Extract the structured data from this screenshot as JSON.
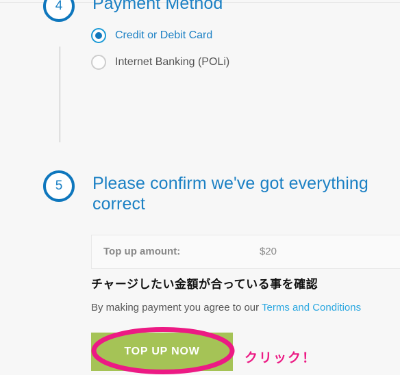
{
  "steps": [
    {
      "number": "4",
      "heading": "Payment Method",
      "options": [
        {
          "label": "Credit or Debit Card",
          "selected": true
        },
        {
          "label": "Internet Banking (POLi)",
          "selected": false
        }
      ]
    },
    {
      "number": "5",
      "heading": "Please confirm we've got everything correct"
    }
  ],
  "summary": {
    "label": "Top up amount:",
    "value": "$20"
  },
  "annotations": {
    "confirm_amount": "チャージしたい金額が合っている事を確認",
    "click_here": "クリック！",
    "highlight_color": "#ec1a84"
  },
  "terms": {
    "prefix": "By making payment you agree to our ",
    "link_text": "Terms and Conditions"
  },
  "button": {
    "label": "TOP UP NOW",
    "color": "#a5c356"
  },
  "colors": {
    "brand_blue": "#1b80c4",
    "step_ring": "#0f77bd",
    "link_blue": "#2aa7e0",
    "background": "#f7f7f7"
  }
}
